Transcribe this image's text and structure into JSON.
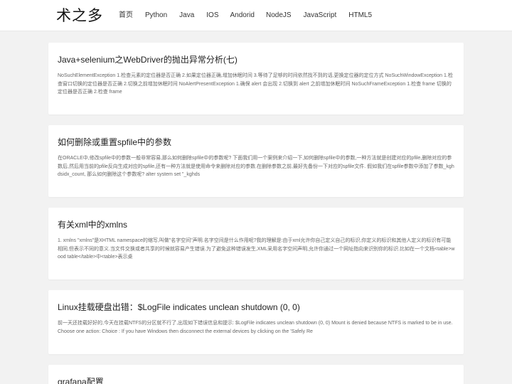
{
  "site": {
    "logo": "术之多"
  },
  "nav": {
    "items": [
      {
        "label": "首页"
      },
      {
        "label": "Python"
      },
      {
        "label": "Java"
      },
      {
        "label": "IOS"
      },
      {
        "label": "Andorid"
      },
      {
        "label": "NodeJS"
      },
      {
        "label": "JavaScript"
      },
      {
        "label": "HTML5"
      }
    ]
  },
  "articles": [
    {
      "title": "Java+selenium之WebDriver的抛出异常分析(七)",
      "excerpt": "NoSuchElementException 1.检查元素的定位器是否正确 2.如果定位器正确,增加休眠时间 3.等待了足够的时间依然找不到的话,更换定位器的定位方式 NoSuchWindowException 1.检查窗口切换的定位器是否正确 2.切换之前增加休眠时间 NoAlertPresentException 1.确保 alert 会出现 2.切换到 alert 之前增加休眠时间 NoSuchFrameException 1.检查 frame 切换的定位器是否正确 2.检查 frame"
    },
    {
      "title": "如何删除或重置spfile中的参数",
      "excerpt": "在ORACLE中,修改spfile中的参数一般非常容易,那么如何删除spfile中的参数呢? 下面我们用一个案例来介绍一下,如何删除spfile中的参数,一种方法就是创建对应的pfile,删除对应的参数后,然后用当前的pfile反向生成对应的spfile,还有一种方法就是使用命令来删除对应的参数.在删除参数之前,最好先备份一下对应的spfile文件. 假如我们在spfile参数中添加了参数_kghdsidx_count, 那么如何删除这个参数呢? alter system set \"_kghds"
    },
    {
      "title": "有关xml中的xmlns",
      "excerpt": "1. xmlns \"xmlns\"是XHTML namespace的缩写,叫做\"名字空间\"声明.名字空间是什么作用呢?我的理解是:由于xml允许你自己定义自己的标识,你定义的标识和其他人定义的标识有可能相同,但表示不同的意义.当文件交换或者共享的时候就容易产生错误.为了避免这种错误发生,XML采用名字空间声明,允许你通过一个网址指向来识别你的标识.比如在一个文档<table>wood table</table>中<table>表示桌"
    },
    {
      "title": "Linux挂载硬盘出错：$LogFile indicates unclean shutdown (0, 0)",
      "excerpt": "前一天还挂载好好的,今天在挂载NTFS的分区就不行了,出现如下错误信息和提示: $LogFile indicates unclean shutdown (0, 0) Mount is denied because NTFS is marked to be in use. Choose one action: Choice : If you have Windows then disconnect the external devices by clicking on the 'Safely Re"
    },
    {
      "title": "grafana配置",
      "excerpt": ""
    }
  ]
}
